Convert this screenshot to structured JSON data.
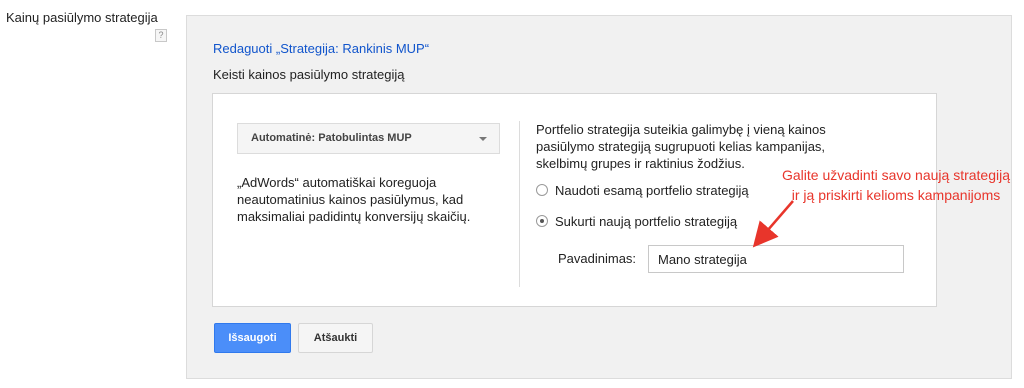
{
  "sidebar": {
    "label": "Kainų pasiūlymo strategija",
    "help_icon": "?"
  },
  "panel": {
    "edit_link": "Redaguoti „Strategija: Rankinis MUP“",
    "subtitle": "Keisti kainos pasiūlymo strategiją",
    "strategy_dropdown": {
      "selected": "Automatinė: Patobulintas MUP",
      "icon": "chevron-down-icon"
    },
    "description": "„AdWords“ automatiškai koreguoja neautomatinius kainos pasiūlymus, kad maksimaliai padidintų konversijų skaičių.",
    "portfolio_text": "Portfelio strategija suteikia galimybę į vieną kainos pasiūlymo strategiją sugrupuoti kelias kampanijas, skelbimų grupes ir raktinius žodžius.",
    "radio_options": [
      {
        "label": "Naudoti esamą portfelio strategiją",
        "checked": false
      },
      {
        "label": "Sukurti naują portfelio strategiją",
        "checked": true
      }
    ],
    "name_field": {
      "label": "Pavadinimas:",
      "value": "Mano strategija"
    },
    "buttons": {
      "save": "Išsaugoti",
      "cancel": "Atšaukti"
    }
  },
  "annotation": {
    "text": "Galite užvadinti savo naują strategiją ir ją priskirti kelioms kampanijoms",
    "color": "#e8352b"
  },
  "colors": {
    "link": "#1155cc",
    "primary_button": "#4b8ef9",
    "panel_bg": "#f1f1f1"
  }
}
